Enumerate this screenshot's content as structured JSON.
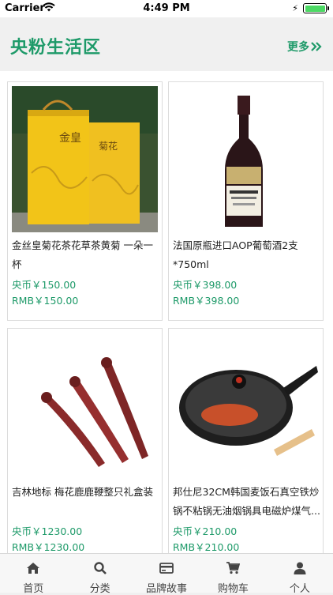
{
  "status_bar": {
    "carrier": "Carrier",
    "time": "4:49 PM"
  },
  "header": {
    "title": "央粉生活区",
    "more_label": "更多"
  },
  "products": [
    {
      "name": "金丝皇菊花茶花草茶黄菊 一朵一杯",
      "price_coin": "央币￥150.00",
      "price_rmb": "RMB￥150.00"
    },
    {
      "name": "法国原瓶进口AOP葡萄酒2支*750ml",
      "price_coin": "央币￥398.00",
      "price_rmb": "RMB￥398.00"
    },
    {
      "name": "吉林地标 梅花鹿鹿鞭整只礼盒装",
      "price_coin": "央币￥1230.00",
      "price_rmb": "RMB￥1230.00"
    },
    {
      "name": "邦仕尼32CM韩国麦饭石真空铁炒锅不粘锅无油烟锅具电磁炉煤气...",
      "price_coin": "央币￥210.00",
      "price_rmb": "RMB￥210.00"
    }
  ],
  "tabbar": {
    "items": [
      {
        "label": "首页",
        "icon": "home-icon"
      },
      {
        "label": "分类",
        "icon": "search-icon"
      },
      {
        "label": "品牌故事",
        "icon": "card-icon"
      },
      {
        "label": "购物车",
        "icon": "cart-icon"
      },
      {
        "label": "个人",
        "icon": "user-icon"
      }
    ]
  },
  "colors": {
    "accent": "#1e9a69",
    "background": "#f0f0f0"
  }
}
